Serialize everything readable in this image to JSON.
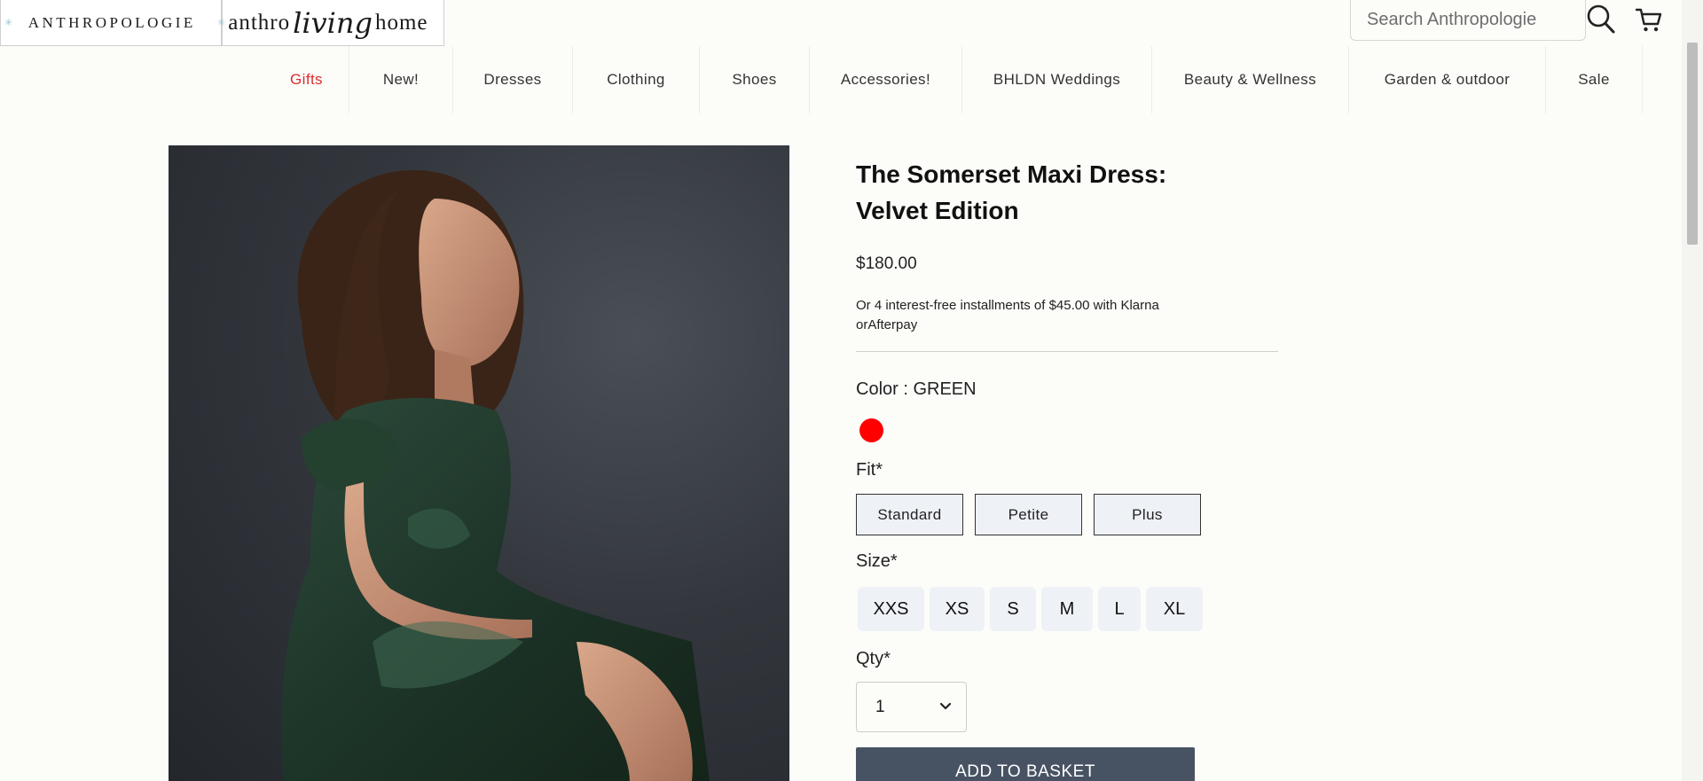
{
  "header": {
    "brand_primary": "ANTHROPOLOGIE",
    "brand_living_left": "anthro",
    "brand_living_script": "living",
    "brand_living_right": "home",
    "search_placeholder": "Search Anthropologie",
    "icons": {
      "search": "search-icon",
      "cart": "cart-icon",
      "star": "star-icon"
    }
  },
  "nav": {
    "items": [
      {
        "label": "Gifts",
        "color": "#d93030"
      },
      {
        "label": "New!"
      },
      {
        "label": "Dresses"
      },
      {
        "label": "Clothing"
      },
      {
        "label": "Shoes"
      },
      {
        "label": "Accessories!"
      },
      {
        "label": "BHLDN Weddings"
      },
      {
        "label": "Beauty & Wellness"
      },
      {
        "label": "Garden & outdoor"
      },
      {
        "label": "Sale"
      }
    ]
  },
  "product": {
    "title": "The Somerset Maxi Dress: Velvet Edition",
    "price": "$180.00",
    "installments": "Or 4 interest-free installments of $45.00 with Klarna orAfterpay",
    "color_label": "Color : GREEN",
    "swatch_color": "#ff0000",
    "fit_label": "Fit*",
    "fit_options": [
      "Standard",
      "Petite",
      "Plus"
    ],
    "size_label": "Size*",
    "size_options": [
      "XXS",
      "XS",
      "S",
      "M",
      "L",
      "XL"
    ],
    "qty_label": "Qty*",
    "qty_value": "1",
    "add_to_basket": "ADD TO BASKET"
  },
  "colors": {
    "accent_red": "#d93030",
    "button_dark": "#475363",
    "option_bg": "#eef1f6",
    "page_bg": "#fcfcf9"
  }
}
